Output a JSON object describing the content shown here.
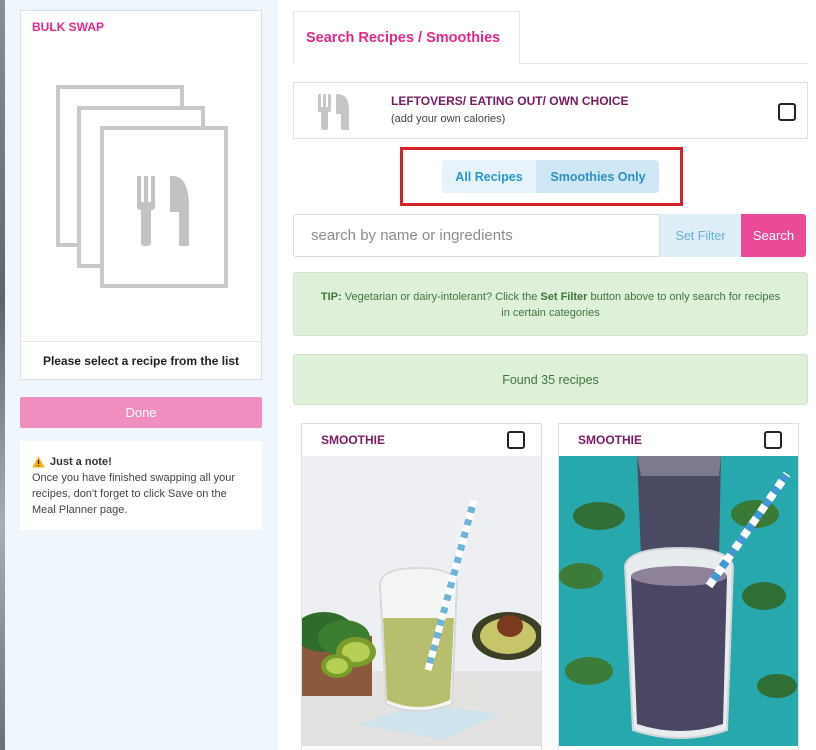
{
  "bulk_swap": {
    "title": "BULK SWAP",
    "placeholder_text": "Please select a recipe from the list",
    "done_label": "Done"
  },
  "note": {
    "title": "Just a note!",
    "body": "Once you have finished swapping all your recipes, don't forget to click Save on the Meal Planner page."
  },
  "tabs": [
    {
      "label": "Search Recipes / Smoothies",
      "active": true
    }
  ],
  "leftovers": {
    "title": "LEFTOVERS/ EATING OUT/ OWN CHOICE",
    "subtitle": "(add your own calories)"
  },
  "filter_toggle": {
    "all_label": "All Recipes",
    "smoothies_label": "Smoothies Only",
    "selected": "Smoothies Only"
  },
  "search": {
    "placeholder": "search by name or ingredients",
    "set_filter_label": "Set Filter",
    "search_label": "Search"
  },
  "tip": {
    "prefix": "TIP:",
    "text_before": " Vegetarian or dairy-intolerant? Click the ",
    "emphasis": "Set Filter",
    "text_after": " button above to only search for recipes in certain categories"
  },
  "results": {
    "found_text": "Found 35 recipes"
  },
  "recipes": [
    {
      "category": "SMOOTHIE",
      "description": "green smoothie"
    },
    {
      "category": "SMOOTHIE",
      "description": "purple smoothie"
    }
  ],
  "colors": {
    "brand_pink": "#e0288a",
    "search_pink": "#ea4a97",
    "done_pink": "#ef8fbf",
    "toggle_blue": "#2b97c7",
    "tip_green_bg": "#dff0d8",
    "tip_green_text": "#3c763d",
    "highlight_red": "#d2232a"
  },
  "icons": [
    "fork-knife-icon",
    "warning-icon",
    "checkbox-icon"
  ]
}
